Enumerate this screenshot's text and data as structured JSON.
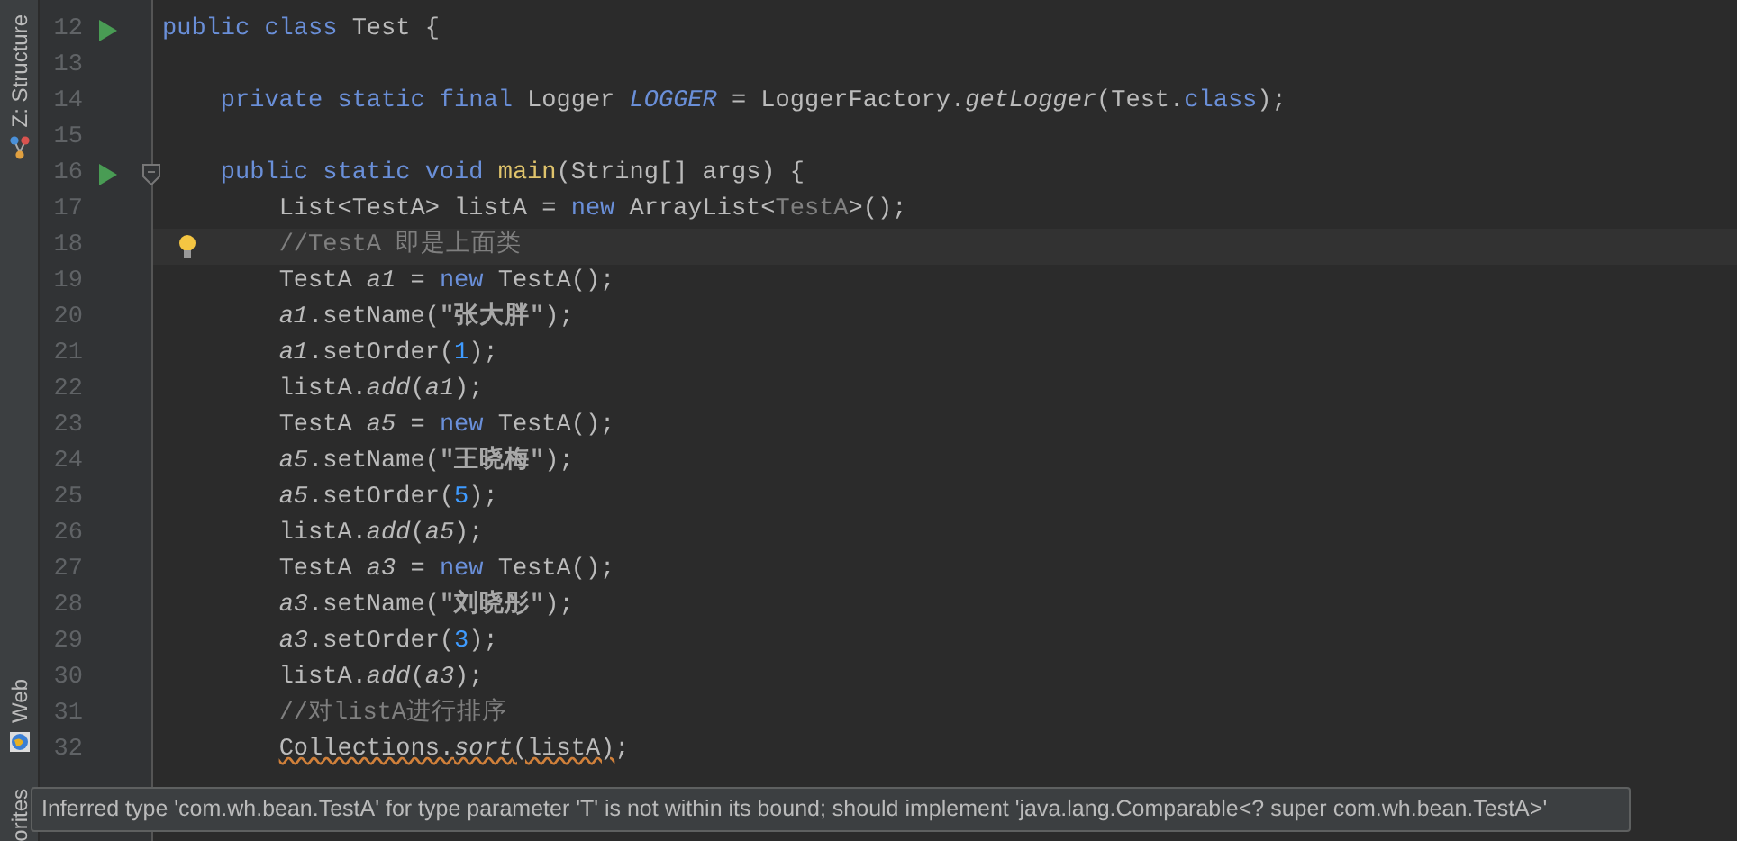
{
  "tool_tabs": [
    {
      "label": "Z: Structure",
      "kind": "structure"
    },
    {
      "label": "Web",
      "kind": "web"
    },
    {
      "label": "orites",
      "kind": "favorites"
    }
  ],
  "lines": [
    {
      "number": "12",
      "run_marker": true,
      "fold_marker": false,
      "bulb": false,
      "current": false,
      "tokens": [
        {
          "text": "public class ",
          "kind": "keyword"
        },
        {
          "text": "Test {",
          "kind": "plain"
        }
      ]
    },
    {
      "number": "13",
      "run_marker": false,
      "fold_marker": false,
      "bulb": false,
      "current": false
    },
    {
      "number": "14",
      "run_marker": false,
      "fold_marker": false,
      "bulb": false,
      "current": false,
      "tokens": [
        {
          "text": "    private static final ",
          "kind": "keyword"
        },
        {
          "text": "Logger ",
          "kind": "plain"
        },
        {
          "text": "LOGGER",
          "kind": "field"
        },
        {
          "text": " = LoggerFactory.",
          "kind": "plain"
        },
        {
          "text": "getLogger",
          "kind": "italic"
        },
        {
          "text": "(Test.",
          "kind": "plain"
        },
        {
          "text": "class",
          "kind": "keyword"
        },
        {
          "text": ");",
          "kind": "plain"
        }
      ]
    },
    {
      "number": "15",
      "run_marker": false,
      "fold_marker": false,
      "bulb": false,
      "current": false
    },
    {
      "number": "16",
      "run_marker": true,
      "fold_marker": true,
      "bulb": false,
      "current": false,
      "tokens": [
        {
          "text": "    public static void ",
          "kind": "keyword"
        },
        {
          "text": "main",
          "kind": "method"
        },
        {
          "text": "(String[] args) {",
          "kind": "plain"
        }
      ]
    },
    {
      "number": "17",
      "run_marker": false,
      "fold_marker": false,
      "bulb": false,
      "current": false,
      "tokens": [
        {
          "text": "        List<TestA> listA = ",
          "kind": "plain"
        },
        {
          "text": "new ",
          "kind": "keyword"
        },
        {
          "text": "ArrayList<",
          "kind": "plain"
        },
        {
          "text": "TestA",
          "kind": "generic"
        },
        {
          "text": ">();",
          "kind": "plain"
        }
      ]
    },
    {
      "number": "18",
      "run_marker": false,
      "fold_marker": false,
      "bulb": true,
      "current": true,
      "tokens": [
        {
          "text": "        //TestA 即是上面类",
          "kind": "comment"
        }
      ]
    },
    {
      "number": "19",
      "run_marker": false,
      "fold_marker": false,
      "bulb": false,
      "current": false,
      "tokens": [
        {
          "text": "        TestA ",
          "kind": "plain"
        },
        {
          "text": "a1",
          "kind": "italic"
        },
        {
          "text": " = ",
          "kind": "plain"
        },
        {
          "text": "new ",
          "kind": "keyword"
        },
        {
          "text": "TestA();",
          "kind": "plain"
        }
      ]
    },
    {
      "number": "20",
      "run_marker": false,
      "fold_marker": false,
      "bulb": false,
      "current": false,
      "tokens": [
        {
          "text": "        a1",
          "kind": "italic"
        },
        {
          "text": ".setName(",
          "kind": "plain"
        },
        {
          "text": "\"张大胖\"",
          "kind": "string"
        },
        {
          "text": ");",
          "kind": "plain"
        }
      ]
    },
    {
      "number": "21",
      "run_marker": false,
      "fold_marker": false,
      "bulb": false,
      "current": false,
      "tokens": [
        {
          "text": "        a1",
          "kind": "italic"
        },
        {
          "text": ".setOrder(",
          "kind": "plain"
        },
        {
          "text": "1",
          "kind": "number"
        },
        {
          "text": ");",
          "kind": "plain"
        }
      ]
    },
    {
      "number": "22",
      "run_marker": false,
      "fold_marker": false,
      "bulb": false,
      "current": false,
      "tokens": [
        {
          "text": "        listA.",
          "kind": "plain"
        },
        {
          "text": "add",
          "kind": "italic"
        },
        {
          "text": "(",
          "kind": "plain"
        },
        {
          "text": "a1",
          "kind": "italic"
        },
        {
          "text": ");",
          "kind": "plain"
        }
      ]
    },
    {
      "number": "23",
      "run_marker": false,
      "fold_marker": false,
      "bulb": false,
      "current": false,
      "tokens": [
        {
          "text": "        TestA ",
          "kind": "plain"
        },
        {
          "text": "a5",
          "kind": "italic"
        },
        {
          "text": " = ",
          "kind": "plain"
        },
        {
          "text": "new ",
          "kind": "keyword"
        },
        {
          "text": "TestA();",
          "kind": "plain"
        }
      ]
    },
    {
      "number": "24",
      "run_marker": false,
      "fold_marker": false,
      "bulb": false,
      "current": false,
      "tokens": [
        {
          "text": "        a5",
          "kind": "italic"
        },
        {
          "text": ".setName(",
          "kind": "plain"
        },
        {
          "text": "\"王晓梅\"",
          "kind": "string"
        },
        {
          "text": ");",
          "kind": "plain"
        }
      ]
    },
    {
      "number": "25",
      "run_marker": false,
      "fold_marker": false,
      "bulb": false,
      "current": false,
      "tokens": [
        {
          "text": "        a5",
          "kind": "italic"
        },
        {
          "text": ".setOrder(",
          "kind": "plain"
        },
        {
          "text": "5",
          "kind": "number"
        },
        {
          "text": ");",
          "kind": "plain"
        }
      ]
    },
    {
      "number": "26",
      "run_marker": false,
      "fold_marker": false,
      "bulb": false,
      "current": false,
      "tokens": [
        {
          "text": "        listA.",
          "kind": "plain"
        },
        {
          "text": "add",
          "kind": "italic"
        },
        {
          "text": "(",
          "kind": "plain"
        },
        {
          "text": "a5",
          "kind": "italic"
        },
        {
          "text": ");",
          "kind": "plain"
        }
      ]
    },
    {
      "number": "27",
      "run_marker": false,
      "fold_marker": false,
      "bulb": false,
      "current": false,
      "tokens": [
        {
          "text": "        TestA ",
          "kind": "plain"
        },
        {
          "text": "a3",
          "kind": "italic"
        },
        {
          "text": " = ",
          "kind": "plain"
        },
        {
          "text": "new ",
          "kind": "keyword"
        },
        {
          "text": "TestA();",
          "kind": "plain"
        }
      ]
    },
    {
      "number": "28",
      "run_marker": false,
      "fold_marker": false,
      "bulb": false,
      "current": false,
      "tokens": [
        {
          "text": "        a3",
          "kind": "italic"
        },
        {
          "text": ".setName(",
          "kind": "plain"
        },
        {
          "text": "\"刘晓彤\"",
          "kind": "string"
        },
        {
          "text": ");",
          "kind": "plain"
        }
      ]
    },
    {
      "number": "29",
      "run_marker": false,
      "fold_marker": false,
      "bulb": false,
      "current": false,
      "tokens": [
        {
          "text": "        a3",
          "kind": "italic"
        },
        {
          "text": ".setOrder(",
          "kind": "plain"
        },
        {
          "text": "3",
          "kind": "number"
        },
        {
          "text": ");",
          "kind": "plain"
        }
      ]
    },
    {
      "number": "30",
      "run_marker": false,
      "fold_marker": false,
      "bulb": false,
      "current": false,
      "tokens": [
        {
          "text": "        listA.",
          "kind": "plain"
        },
        {
          "text": "add",
          "kind": "italic"
        },
        {
          "text": "(",
          "kind": "plain"
        },
        {
          "text": "a3",
          "kind": "italic"
        },
        {
          "text": ");",
          "kind": "plain"
        }
      ]
    },
    {
      "number": "31",
      "run_marker": false,
      "fold_marker": false,
      "bulb": false,
      "current": false,
      "tokens": [
        {
          "text": "        //对listA进行排序",
          "kind": "comment"
        }
      ]
    },
    {
      "number": "32",
      "run_marker": false,
      "fold_marker": false,
      "bulb": false,
      "current": false,
      "tokens": [
        {
          "text": "        Collections.",
          "kind": "plain",
          "warning": true
        },
        {
          "text": "sort",
          "kind": "italic",
          "warning": true
        },
        {
          "text": "(listA)",
          "kind": "plain",
          "warning": true
        },
        {
          "text": ";",
          "kind": "plain"
        }
      ]
    }
  ],
  "tooltip": {
    "text": "Inferred type 'com.wh.bean.TestA' for type parameter 'T' is not within its bound; should implement 'java.lang.Comparable<? super com.wh.bean.TestA>'"
  }
}
